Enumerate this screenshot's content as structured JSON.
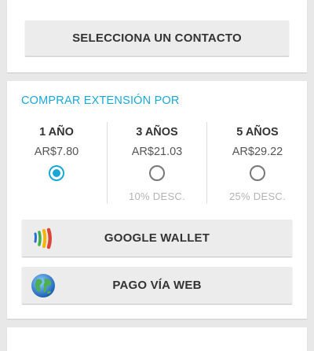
{
  "contact": {
    "button_label": "SELECCIONA UN CONTACTO"
  },
  "extension": {
    "title": "COMPRAR EXTENSIÓN POR",
    "options": [
      {
        "years": "1 AÑO",
        "price": "AR$7.80",
        "discount": "",
        "selected": true
      },
      {
        "years": "3 AÑOS",
        "price": "AR$21.03",
        "discount": "10% DESC.",
        "selected": false
      },
      {
        "years": "5 AÑOS",
        "price": "AR$29.22",
        "discount": "25% DESC.",
        "selected": false
      }
    ]
  },
  "payment": {
    "wallet_label": "GOOGLE WALLET",
    "wallet_icon": "google-wallet-icon",
    "web_label": "PAGO VÍA WEB",
    "web_icon": "globe-icon"
  },
  "colors": {
    "accent": "#1aa7d6",
    "background": "#e8e8e8",
    "button": "#ececec"
  }
}
